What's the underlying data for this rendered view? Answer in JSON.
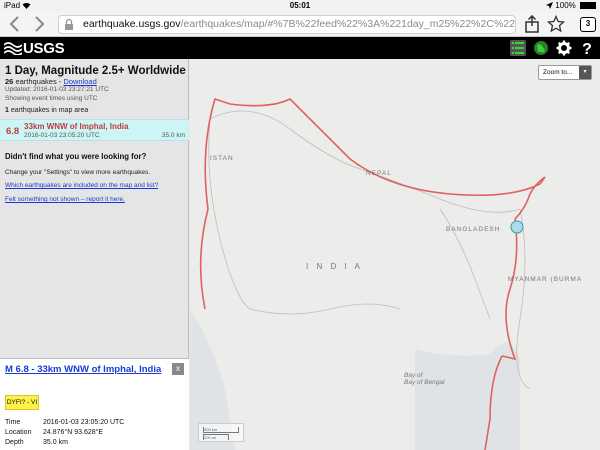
{
  "status": {
    "device": "iPad",
    "wifi": "wifi-icon",
    "time": "05:01",
    "battery": "100%"
  },
  "browser": {
    "url_host": "earthquake.usgs.gov",
    "url_path": "/earthquakes/map/#%7B%22feed%22%3A%221day_m25%22%2C%22search%22%3Anu...",
    "tab_count": "3"
  },
  "header": {
    "logo": "USGS"
  },
  "sidebar": {
    "title": "1 Day, Magnitude 2.5+ Worldwide",
    "count": "26",
    "count_label": "earthquakes -",
    "download": "Download",
    "updated": "Updated: 2016-01-03 23:27:21 UTC",
    "times": "Showing event times using UTC",
    "in_area_count": "1",
    "in_area_label": "earthquakes in map area",
    "event": {
      "mag": "6.8",
      "place": "33km WNW of Imphal, India",
      "time": "2016-01-03 23:05:20 UTC",
      "depth": "35.0 km"
    },
    "not_found": "Didn't find what you were looking for?",
    "settings_hint": "Change your \"Settings\" to view more earthquakes.",
    "link_which": "Which earthquakes are included on the map and list?",
    "link_felt": "Felt something not shown – report it here."
  },
  "popup": {
    "title": "M 6.8 - 33km WNW of Imphal, India",
    "close": "x",
    "dyfi": "DYFI? - VI",
    "rows": [
      {
        "k": "Time",
        "v": "2016-01-03 23:05:20 UTC"
      },
      {
        "k": "Location",
        "v": "24.876°N 93.628°E"
      },
      {
        "k": "Depth",
        "v": "35.0 km"
      }
    ]
  },
  "map": {
    "zoom": "Zoom to...",
    "labels": {
      "istan": "ISTAN",
      "nepal": "NEPAL",
      "bangladesh": "BANGLADESH",
      "india": "I N D I A",
      "myanmar": "MYANMAR (BURMA",
      "bay1": "Bay of",
      "bay2": "Bay of Bengal"
    },
    "scale_km": "300 km",
    "scale_mi": "200 mi"
  },
  "colors": {
    "accent": "#1a3bd1",
    "plate": "#e0615f",
    "quake": "#a9dde8",
    "list_active": "#ccf6f6",
    "mag": "#c2393b"
  }
}
